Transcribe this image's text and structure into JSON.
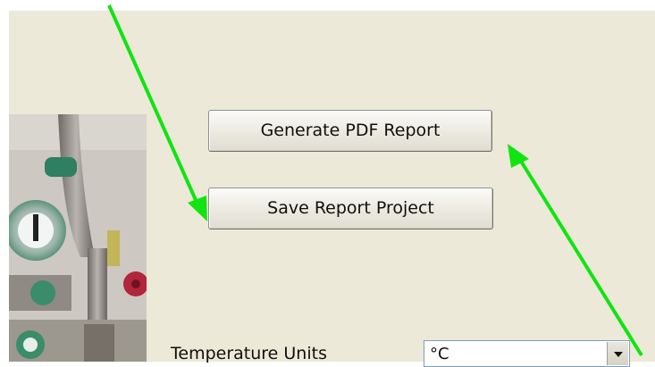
{
  "buttons": {
    "generate_pdf_label": "Generate PDF Report",
    "save_project_label": "Save Report Project"
  },
  "settings": {
    "temperature_units_label": "Temperature Units",
    "temperature_units_value": "°C"
  },
  "colors": {
    "annotation_arrow": "#11e411",
    "panel_background": "#ece9d8"
  }
}
